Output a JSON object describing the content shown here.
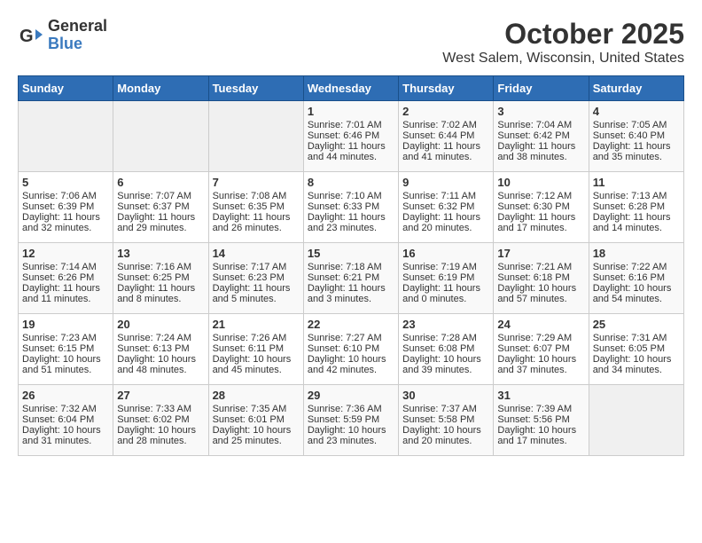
{
  "header": {
    "logo_line1": "General",
    "logo_line2": "Blue",
    "title": "October 2025",
    "subtitle": "West Salem, Wisconsin, United States"
  },
  "days_of_week": [
    "Sunday",
    "Monday",
    "Tuesday",
    "Wednesday",
    "Thursday",
    "Friday",
    "Saturday"
  ],
  "weeks": [
    [
      {
        "day": "",
        "data": ""
      },
      {
        "day": "",
        "data": ""
      },
      {
        "day": "",
        "data": ""
      },
      {
        "day": "1",
        "data": "Sunrise: 7:01 AM\nSunset: 6:46 PM\nDaylight: 11 hours and 44 minutes."
      },
      {
        "day": "2",
        "data": "Sunrise: 7:02 AM\nSunset: 6:44 PM\nDaylight: 11 hours and 41 minutes."
      },
      {
        "day": "3",
        "data": "Sunrise: 7:04 AM\nSunset: 6:42 PM\nDaylight: 11 hours and 38 minutes."
      },
      {
        "day": "4",
        "data": "Sunrise: 7:05 AM\nSunset: 6:40 PM\nDaylight: 11 hours and 35 minutes."
      }
    ],
    [
      {
        "day": "5",
        "data": "Sunrise: 7:06 AM\nSunset: 6:39 PM\nDaylight: 11 hours and 32 minutes."
      },
      {
        "day": "6",
        "data": "Sunrise: 7:07 AM\nSunset: 6:37 PM\nDaylight: 11 hours and 29 minutes."
      },
      {
        "day": "7",
        "data": "Sunrise: 7:08 AM\nSunset: 6:35 PM\nDaylight: 11 hours and 26 minutes."
      },
      {
        "day": "8",
        "data": "Sunrise: 7:10 AM\nSunset: 6:33 PM\nDaylight: 11 hours and 23 minutes."
      },
      {
        "day": "9",
        "data": "Sunrise: 7:11 AM\nSunset: 6:32 PM\nDaylight: 11 hours and 20 minutes."
      },
      {
        "day": "10",
        "data": "Sunrise: 7:12 AM\nSunset: 6:30 PM\nDaylight: 11 hours and 17 minutes."
      },
      {
        "day": "11",
        "data": "Sunrise: 7:13 AM\nSunset: 6:28 PM\nDaylight: 11 hours and 14 minutes."
      }
    ],
    [
      {
        "day": "12",
        "data": "Sunrise: 7:14 AM\nSunset: 6:26 PM\nDaylight: 11 hours and 11 minutes."
      },
      {
        "day": "13",
        "data": "Sunrise: 7:16 AM\nSunset: 6:25 PM\nDaylight: 11 hours and 8 minutes."
      },
      {
        "day": "14",
        "data": "Sunrise: 7:17 AM\nSunset: 6:23 PM\nDaylight: 11 hours and 5 minutes."
      },
      {
        "day": "15",
        "data": "Sunrise: 7:18 AM\nSunset: 6:21 PM\nDaylight: 11 hours and 3 minutes."
      },
      {
        "day": "16",
        "data": "Sunrise: 7:19 AM\nSunset: 6:19 PM\nDaylight: 11 hours and 0 minutes."
      },
      {
        "day": "17",
        "data": "Sunrise: 7:21 AM\nSunset: 6:18 PM\nDaylight: 10 hours and 57 minutes."
      },
      {
        "day": "18",
        "data": "Sunrise: 7:22 AM\nSunset: 6:16 PM\nDaylight: 10 hours and 54 minutes."
      }
    ],
    [
      {
        "day": "19",
        "data": "Sunrise: 7:23 AM\nSunset: 6:15 PM\nDaylight: 10 hours and 51 minutes."
      },
      {
        "day": "20",
        "data": "Sunrise: 7:24 AM\nSunset: 6:13 PM\nDaylight: 10 hours and 48 minutes."
      },
      {
        "day": "21",
        "data": "Sunrise: 7:26 AM\nSunset: 6:11 PM\nDaylight: 10 hours and 45 minutes."
      },
      {
        "day": "22",
        "data": "Sunrise: 7:27 AM\nSunset: 6:10 PM\nDaylight: 10 hours and 42 minutes."
      },
      {
        "day": "23",
        "data": "Sunrise: 7:28 AM\nSunset: 6:08 PM\nDaylight: 10 hours and 39 minutes."
      },
      {
        "day": "24",
        "data": "Sunrise: 7:29 AM\nSunset: 6:07 PM\nDaylight: 10 hours and 37 minutes."
      },
      {
        "day": "25",
        "data": "Sunrise: 7:31 AM\nSunset: 6:05 PM\nDaylight: 10 hours and 34 minutes."
      }
    ],
    [
      {
        "day": "26",
        "data": "Sunrise: 7:32 AM\nSunset: 6:04 PM\nDaylight: 10 hours and 31 minutes."
      },
      {
        "day": "27",
        "data": "Sunrise: 7:33 AM\nSunset: 6:02 PM\nDaylight: 10 hours and 28 minutes."
      },
      {
        "day": "28",
        "data": "Sunrise: 7:35 AM\nSunset: 6:01 PM\nDaylight: 10 hours and 25 minutes."
      },
      {
        "day": "29",
        "data": "Sunrise: 7:36 AM\nSunset: 5:59 PM\nDaylight: 10 hours and 23 minutes."
      },
      {
        "day": "30",
        "data": "Sunrise: 7:37 AM\nSunset: 5:58 PM\nDaylight: 10 hours and 20 minutes."
      },
      {
        "day": "31",
        "data": "Sunrise: 7:39 AM\nSunset: 5:56 PM\nDaylight: 10 hours and 17 minutes."
      },
      {
        "day": "",
        "data": ""
      }
    ]
  ]
}
